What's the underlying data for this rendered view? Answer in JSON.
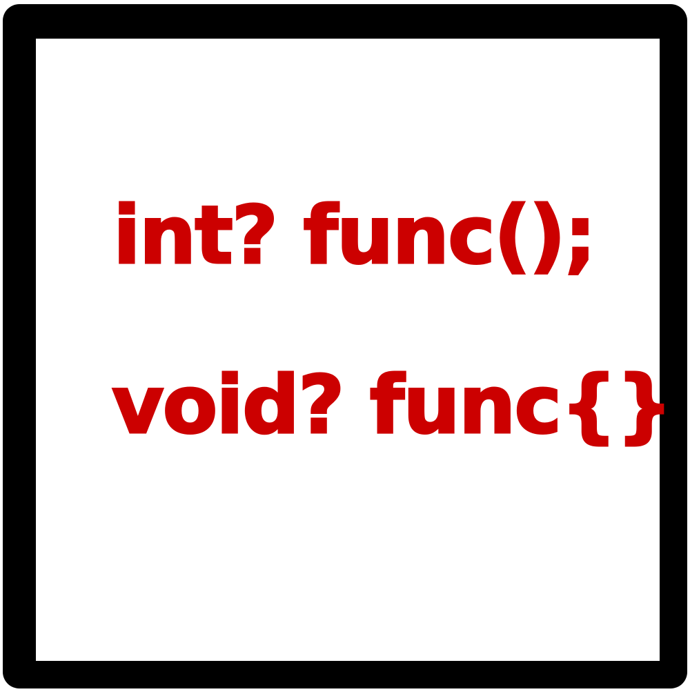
{
  "colors": {
    "frame": "#000000",
    "background": "#ffffff",
    "ink": "#cc0000"
  },
  "drawing": {
    "lines": [
      "int? func();",
      "void? func{}"
    ]
  }
}
